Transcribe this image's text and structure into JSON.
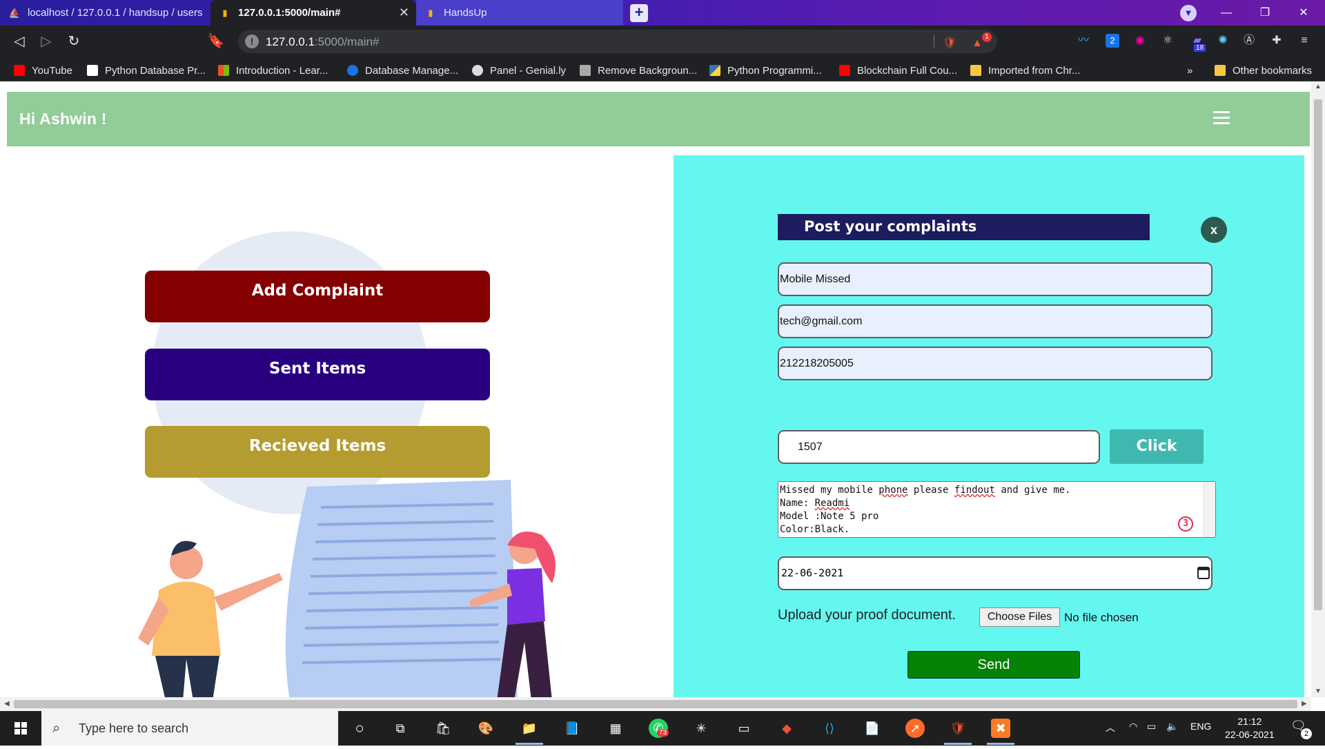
{
  "browser": {
    "tabs": [
      {
        "title": "localhost / 127.0.0.1 / handsup / users",
        "active": false
      },
      {
        "title": "127.0.0.1:5000/main#",
        "active": true
      },
      {
        "title": "HandsUp",
        "active": false
      }
    ],
    "url_host": "127.0.0.1",
    "url_path": ":5000/main#",
    "brave_badge": "1",
    "extension_badge": "18",
    "bookmarks": [
      {
        "label": "YouTube",
        "color": "#ff0000"
      },
      {
        "label": "Python Database Pr...",
        "color": "#ffffff"
      },
      {
        "label": "Introduction - Lear...",
        "color": "#f25022"
      },
      {
        "label": "Database Manage...",
        "color": "#1a73e8"
      },
      {
        "label": "Panel - Genial.ly",
        "color": "#dddddd"
      },
      {
        "label": "Remove Backgroun...",
        "color": "#aaaaaa"
      },
      {
        "label": "Python Programmi...",
        "color": "#ffd43b"
      },
      {
        "label": "Blockchain Full Cou...",
        "color": "#ff0000"
      },
      {
        "label": "Imported from Chr...",
        "color": "#f6c744"
      }
    ],
    "bookmarks_overflow": "»",
    "other_bookmarks": "Other bookmarks"
  },
  "header": {
    "greeting": "Hi Ashwin !",
    "bg_color": "#92cc99"
  },
  "actions": [
    {
      "label": "Add Complaint",
      "color": "#850000"
    },
    {
      "label": "Sent Items",
      "color": "#290080"
    },
    {
      "label": "Recieved Items",
      "color": "#b49c30"
    }
  ],
  "form": {
    "title": "Post your complaints",
    "close_label": "x",
    "subject": "Mobile Missed",
    "email": "tech@gmail.com",
    "reg_number": "212218205005",
    "code": "1507",
    "click_label": "Click",
    "description_lines": [
      "Missed my mobile phone please findout and give me.",
      "Name: Readmi",
      "Model :Note 5 pro",
      "Color:Black."
    ],
    "grammar_badge": "3",
    "date": "22-06-2021",
    "upload_label": "Upload your proof document.",
    "choose_files": "Choose Files",
    "no_file": "No file chosen",
    "send_label": "Send",
    "bg_color": "#64f7f0"
  },
  "taskbar": {
    "search_placeholder": "Type here to search",
    "whatsapp_badge": "73",
    "language": "ENG",
    "time": "21:12",
    "date": "22-06-2021",
    "notifications": "2"
  }
}
